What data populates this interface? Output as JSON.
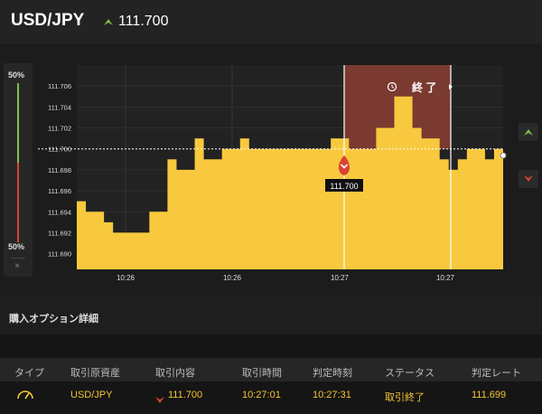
{
  "header": {
    "pair": "USD/JPY",
    "rate": "111.700",
    "rate_direction": "up-arrow-icon"
  },
  "colors": {
    "area_fill": "#f8c93e",
    "expired_zone": "#7a3a30",
    "up_green": "#7fc045",
    "down_red": "#d84532",
    "accent_text": "#f5c533"
  },
  "left_panel": {
    "top_pct": "50%",
    "bottom_pct": "50%",
    "close": "×"
  },
  "chart": {
    "status_label": "終 了",
    "marker_rate": "111.700",
    "y_ticks": [
      "111.706",
      "111.704",
      "111.702",
      "111.700",
      "111.698",
      "111.696",
      "111.694",
      "111.692",
      "111.690"
    ],
    "x_ticks": [
      "10:26",
      "10:26",
      "10:27",
      "10:27"
    ]
  },
  "chart_data": {
    "type": "area",
    "ylim": [
      111.6885,
      111.708
    ],
    "y": [
      111.695,
      111.694,
      111.694,
      111.693,
      111.692,
      111.692,
      111.692,
      111.692,
      111.694,
      111.694,
      111.699,
      111.698,
      111.698,
      111.701,
      111.699,
      111.699,
      111.7,
      111.7,
      111.701,
      111.7,
      111.7,
      111.7,
      111.7,
      111.7,
      111.7,
      111.7,
      111.7,
      111.7,
      111.701,
      111.701,
      111.7,
      111.7,
      111.7,
      111.702,
      111.702,
      111.705,
      111.705,
      111.702,
      111.701,
      111.701,
      111.699,
      111.698,
      111.699,
      111.7,
      111.7,
      111.699,
      111.7,
      111.7
    ],
    "strike": 111.7,
    "entry_label": "111.700"
  },
  "section": {
    "title": "購入オプション詳細"
  },
  "table": {
    "headers": [
      "タイプ",
      "取引原資産",
      "取引内容",
      "取引時間",
      "判定時刻",
      "ステータス",
      "判定レート"
    ],
    "row": {
      "type_icon": "gauge-icon",
      "asset": "USD/JPY",
      "direction_icon": "down-arrow-icon",
      "content": "111.700",
      "trade_time": "10:27:01",
      "judge_time": "10:27:31",
      "status": "取引終了",
      "rate": "111.699"
    }
  }
}
